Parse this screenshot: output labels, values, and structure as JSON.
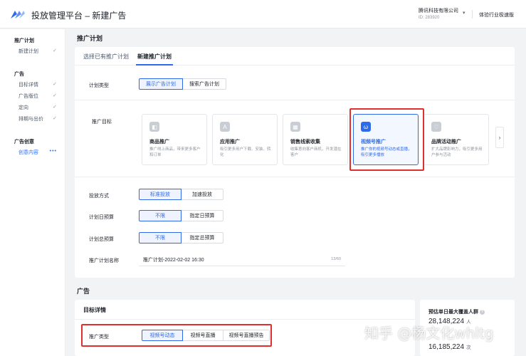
{
  "header": {
    "title": "投放管理平台 – 新建广告",
    "company_name": "腾讯科技有限公司",
    "company_id": "ID: 283920",
    "speed_link": "体验行业极速版"
  },
  "sidebar": {
    "groups": [
      {
        "title": "推广计划",
        "items": [
          {
            "label": "新建计划",
            "mark": "✓"
          }
        ]
      },
      {
        "title": "广告",
        "items": [
          {
            "label": "目标详情",
            "mark": "✓"
          },
          {
            "label": "广告版位",
            "mark": "✓"
          },
          {
            "label": "定向",
            "mark": "✓"
          },
          {
            "label": "排期与出价",
            "mark": "✓"
          }
        ]
      },
      {
        "title": "广告创意",
        "items": [
          {
            "label": "创意内容",
            "mark": "•••"
          }
        ]
      }
    ]
  },
  "plan_section": {
    "title": "推广计划",
    "tabs": [
      "选择已有推广计划",
      "新建推广计划"
    ],
    "plan_type": {
      "label": "计划类型",
      "options": [
        "展示广告计划",
        "搜索广告计划"
      ],
      "selected": 0
    },
    "goal": {
      "label": "推广目标",
      "cards": [
        {
          "name": "商品推广",
          "desc": "推广线上商品，带来更多客户和订单",
          "icon": "bag-icon",
          "glyph": "◧"
        },
        {
          "name": "应用推广",
          "desc": "吸引更多用户下载、安装、转化",
          "icon": "app-icon",
          "glyph": "A"
        },
        {
          "name": "销售线索收集",
          "desc": "收集意向客户商机，开发潜在客户",
          "icon": "image-icon",
          "glyph": "▦"
        },
        {
          "name": "视频号推广",
          "desc": "推广你的视频号动态或直播，吸引更多播放",
          "icon": "channels-icon",
          "glyph": "ω"
        },
        {
          "name": "品牌活动推广",
          "desc": "扩大品牌影响力，吸引更多用户参与活动",
          "icon": "heart-icon",
          "glyph": "♡"
        }
      ],
      "selected": 3
    },
    "delivery": {
      "label": "投放方式",
      "options": [
        "标准投放",
        "加速投放"
      ],
      "selected": 0
    },
    "daily_budget": {
      "label": "计划日预算",
      "options": [
        "不限",
        "指定日预算"
      ],
      "selected": 0
    },
    "total_budget": {
      "label": "计划总预算",
      "options": [
        "不限",
        "指定总预算"
      ],
      "selected": 0
    },
    "plan_name": {
      "label": "推广计划名称",
      "value": "推广计划-2022-02-02 16:30",
      "counter": "13/60"
    }
  },
  "ad_section": {
    "title": "广告",
    "target_title": "目标详情",
    "promo_type": {
      "label": "推广类型",
      "options": [
        "视频号动态",
        "视频号直播",
        "视频号直播预告"
      ],
      "selected": 0
    }
  },
  "estimate": {
    "title": "预估单日最大覆盖人群",
    "stats": [
      {
        "value": "28,148,224",
        "unit": "人"
      },
      {
        "value": "",
        "unit": ""
      },
      {
        "value": "16,185,224",
        "unit": "次"
      }
    ]
  },
  "watermark": "知乎 @杨文化whltg"
}
